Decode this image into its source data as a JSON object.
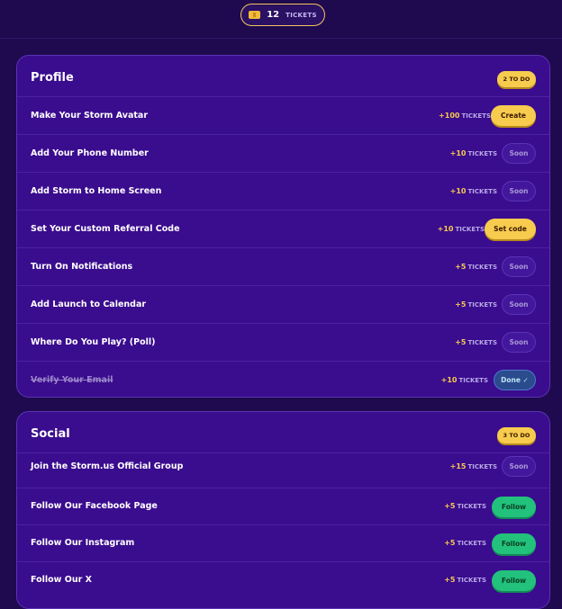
{
  "header": {
    "tickets_count": "12",
    "tickets_label": "TICKETS"
  },
  "profile": {
    "title": "Profile",
    "badge": "2 TO DO",
    "rows": [
      {
        "label": "Make Your Storm Avatar",
        "reward": "+100",
        "unit": "TICKETS",
        "action": "Create"
      },
      {
        "label": "Add Your Phone Number",
        "reward": "+10",
        "unit": "TICKETS",
        "action": "Soon"
      },
      {
        "label": "Add Storm to Home Screen",
        "reward": "+10",
        "unit": "TICKETS",
        "action": "Soon"
      },
      {
        "label": "Set Your Custom Referral Code",
        "reward": "+10",
        "unit": "TICKETS",
        "action": "Set code"
      },
      {
        "label": "Turn On Notifications",
        "reward": "+5",
        "unit": "TICKETS",
        "action": "Soon"
      },
      {
        "label": "Add Launch to Calendar",
        "reward": "+5",
        "unit": "TICKETS",
        "action": "Soon"
      },
      {
        "label": "Where Do You Play? (Poll)",
        "reward": "+5",
        "unit": "TICKETS",
        "action": "Soon"
      },
      {
        "label": "Verify Your Email",
        "reward": "+10",
        "unit": "TICKETS",
        "action": "Done ✓"
      }
    ]
  },
  "social": {
    "title": "Social",
    "badge": "3 TO DO",
    "rows": [
      {
        "label": "Join the Storm.us Official Group",
        "reward": "+15",
        "unit": "TICKETS",
        "action": "Soon"
      },
      {
        "label": "Follow Our Facebook Page",
        "reward": "+5",
        "unit": "TICKETS",
        "action": "Follow"
      },
      {
        "label": "Follow Our Instagram",
        "reward": "+5",
        "unit": "TICKETS",
        "action": "Follow"
      },
      {
        "label": "Follow Our X",
        "reward": "+5",
        "unit": "TICKETS",
        "action": "Follow"
      }
    ]
  },
  "colors": {
    "background": "#1f0a4f",
    "card": "#3a0c8e",
    "accent_yellow": "#f7cb4e",
    "accent_green": "#22c17c",
    "done_blue": "#2a4b8d"
  }
}
